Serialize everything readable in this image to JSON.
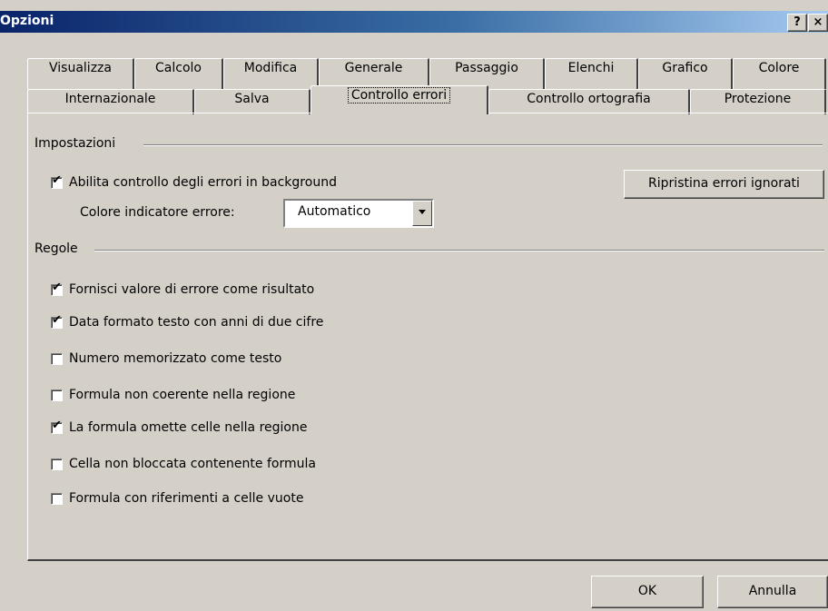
{
  "window": {
    "title": "Opzioni",
    "help_button": "?",
    "close_button": "×"
  },
  "tabs": {
    "row1": [
      "Visualizza",
      "Calcolo",
      "Modifica",
      "Generale",
      "Passaggio",
      "Elenchi",
      "Grafico",
      "Colore"
    ],
    "row2": [
      "Internazionale",
      "Salva",
      "Controllo errori",
      "Controllo ortografia",
      "Protezione"
    ],
    "active": "Controllo errori"
  },
  "impostazioni": {
    "heading": "Impostazioni",
    "background_check": {
      "label": "Abilita controllo degli errori in background",
      "checked": true
    },
    "color_label": "Colore indicatore errore:",
    "color_value": "Automatico",
    "reset_button": "Ripristina errori ignorati"
  },
  "regole": {
    "heading": "Regole",
    "rules": [
      {
        "label": "Fornisci  valore di errore come risultato",
        "checked": true
      },
      {
        "label": "Data formato testo con anni di due cifre",
        "checked": true
      },
      {
        "label": "Numero memorizzato come testo",
        "checked": false
      },
      {
        "label": "Formula non coerente nella regione",
        "checked": false
      },
      {
        "label": "La formula omette celle nella regione",
        "checked": true
      },
      {
        "label": "Cella non bloccata contenente formula",
        "checked": false
      },
      {
        "label": "Formula con riferimenti a celle vuote",
        "checked": false
      }
    ]
  },
  "footer": {
    "ok": "OK",
    "cancel": "Annulla"
  }
}
